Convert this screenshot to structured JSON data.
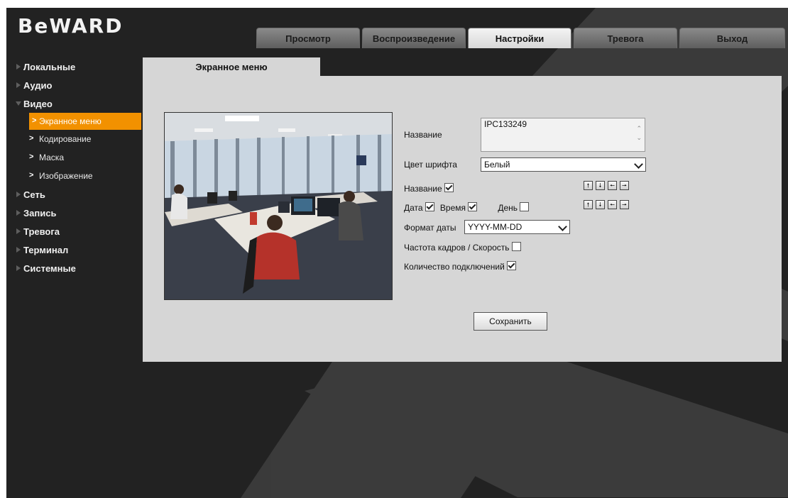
{
  "brand": {
    "logo": "BeWARD"
  },
  "top_tabs": [
    {
      "label": "Просмотр",
      "active": false
    },
    {
      "label": "Воспроизведение",
      "active": false
    },
    {
      "label": "Настройки",
      "active": true
    },
    {
      "label": "Тревога",
      "active": false
    },
    {
      "label": "Выход",
      "active": false
    }
  ],
  "sidebar": {
    "items": [
      {
        "label": "Локальные"
      },
      {
        "label": "Аудио"
      },
      {
        "label": "Видео",
        "expanded": true
      },
      {
        "label": "Сеть"
      },
      {
        "label": "Запись"
      },
      {
        "label": "Тревога"
      },
      {
        "label": "Терминал"
      },
      {
        "label": "Системные"
      }
    ],
    "video_subitems": [
      {
        "label": "Экранное меню",
        "active": true
      },
      {
        "label": "Кодирование"
      },
      {
        "label": "Маска"
      },
      {
        "label": "Изображение"
      }
    ]
  },
  "page": {
    "tab_title": "Экранное меню",
    "form": {
      "name_label": "Название",
      "name_value": "IPC133249",
      "font_color_label": "Цвет шрифта",
      "font_color_value": "Белый",
      "show_name_label": "Название",
      "show_name_checked": true,
      "date_label": "Дата",
      "date_checked": true,
      "time_label": "Время",
      "time_checked": true,
      "day_label": "День",
      "day_checked": false,
      "date_format_label": "Формат даты",
      "date_format_value": "YYYY-MM-DD",
      "fps_label": "Частота кадров / Скорость",
      "fps_checked": false,
      "connections_label": "Количество подключений",
      "connections_checked": true,
      "save_label": "Сохранить"
    }
  },
  "colors": {
    "background": "#222222",
    "panel": "#d6d6d6",
    "accent": "#f29100"
  }
}
